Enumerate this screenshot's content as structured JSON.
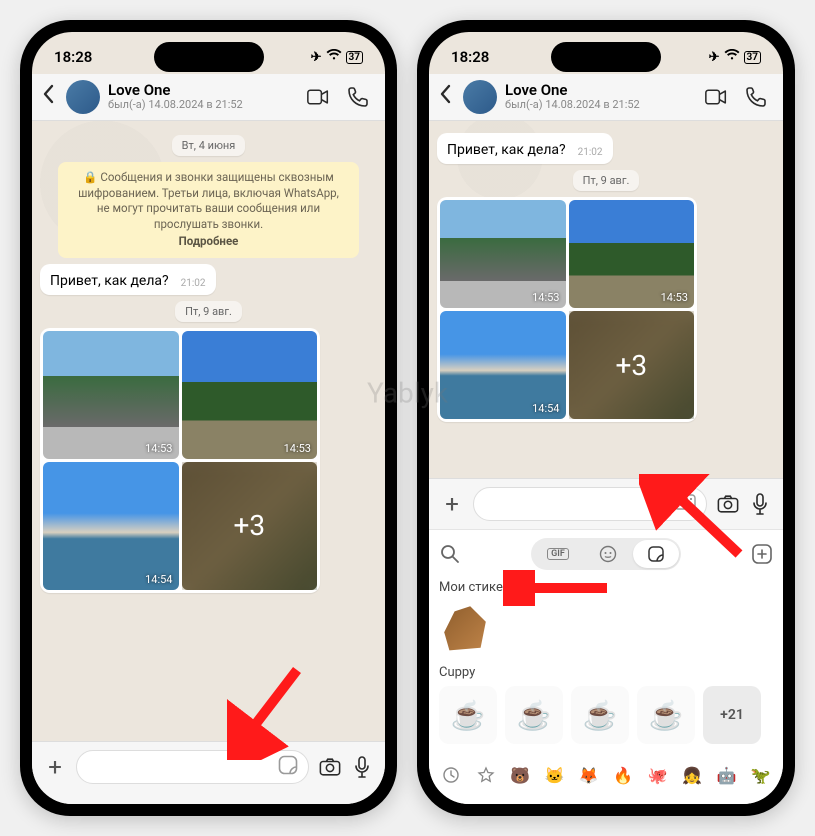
{
  "status": {
    "time": "18:28",
    "battery": "37"
  },
  "header": {
    "contact_name": "Love One",
    "last_seen": "был(-а) 14.08.2024 в 21:52"
  },
  "chat": {
    "date1": "Вт, 4 июня",
    "encryption_lock": "🔒",
    "encryption_notice": "Сообщения и звонки защищены сквозным шифрованием. Третьи лица, включая WhatsApp, не могут прочитать ваши сообщения или прослушать звонки.",
    "encryption_more": "Подробнее",
    "msg1_text": "Привет, как дела?",
    "msg1_time": "21:02",
    "date2": "Пт, 9 авг.",
    "media": {
      "t1": "14:53",
      "t2": "14:53",
      "t3": "14:54",
      "more": "+3"
    }
  },
  "picker": {
    "gif_label": "GIF",
    "my_stickers_title": "Мои стикеры",
    "cuppy_title": "Cuppy",
    "cuppy_more": "+21"
  },
  "watermark": "Yablyk"
}
